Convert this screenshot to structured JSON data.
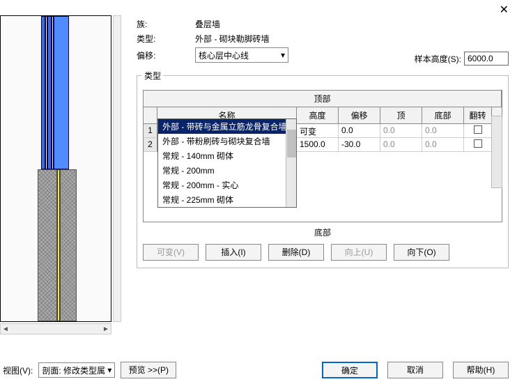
{
  "close_icon": "✕",
  "info": {
    "family_label": "族:",
    "family_value": "叠层墙",
    "type_label": "类型:",
    "type_value": "外部 - 砌块勒脚砖墙",
    "offset_label": "偏移:",
    "offset_value": "核心层中心线"
  },
  "sample_height": {
    "label": "样本高度(S):",
    "value": "6000.0"
  },
  "type_group": {
    "legend": "类型",
    "top_label": "顶部",
    "bottom_label": "底部",
    "columns": {
      "name": "名称",
      "height": "高度",
      "offset": "偏移",
      "top": "顶",
      "bottom": "底部",
      "flip": "翻转"
    },
    "rows": [
      {
        "num": "1",
        "name": "外部 - 带砖与金属立筋龙骨复合墙",
        "height": "可变",
        "offset": "0.0",
        "top": "0.0",
        "bottom": "0.0"
      },
      {
        "num": "2",
        "name": "外部 - 带砖与金属立筋龙骨复合墙",
        "height": "1500.0",
        "offset": "-30.0",
        "top": "0.0",
        "bottom": "0.0"
      }
    ],
    "dropdown": [
      "外部 - 带砖与金属立筋龙骨复合墙",
      "外部 - 带粉刷砖与砌块复合墙",
      "常规 - 140mm 砌体",
      "常规 - 200mm",
      "常规 - 200mm - 实心",
      "常规 - 225mm 砌体"
    ],
    "buttons": {
      "variable": "可变(V)",
      "insert": "插入(I)",
      "delete": "删除(D)",
      "up": "向上(U)",
      "down": "向下(O)"
    }
  },
  "footer": {
    "view_label": "视图(V):",
    "view_combo": "剖面: 修改类型属",
    "preview": "预览 >>(P)",
    "ok": "确定",
    "cancel": "取消",
    "help": "帮助(H)"
  }
}
